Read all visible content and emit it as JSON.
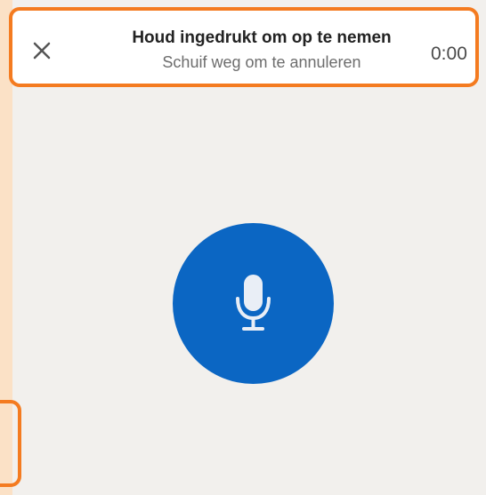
{
  "header": {
    "title": "Houd ingedrukt om op te nemen",
    "subtitle": "Schuif weg om te annuleren",
    "timer": "0:00",
    "close_icon": "close-icon"
  },
  "recorder": {
    "record_icon": "microphone-icon"
  },
  "colors": {
    "accent_orange": "#f47b20",
    "record_blue": "#0b66c3",
    "background": "#f2f0ed",
    "left_strip": "#fbe1c6"
  }
}
